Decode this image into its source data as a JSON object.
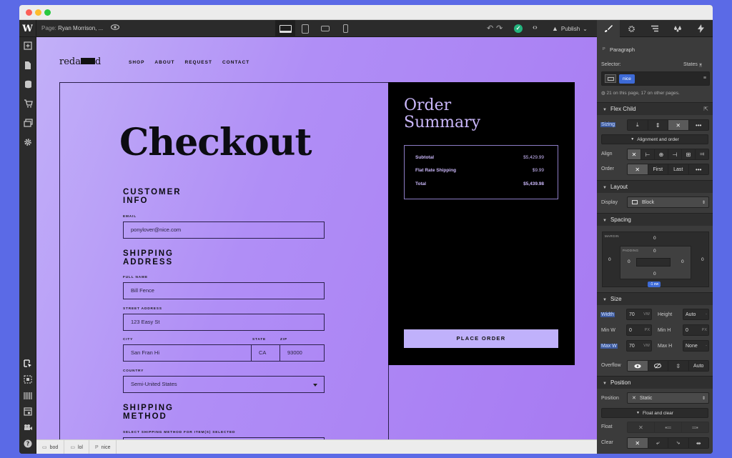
{
  "toolbar": {
    "logo": "W",
    "page_key": "Page:",
    "page_name": "Ryan Morrison, ...",
    "undo": "↶",
    "redo": "↷",
    "check": "✓",
    "code": "‹›",
    "publish_label": "Publish"
  },
  "site": {
    "logo_a": "reda",
    "logo_b": "d",
    "nav": [
      "SHOP",
      "ABOUT",
      "REQUEST",
      "CONTACT"
    ],
    "title": "Checkout",
    "customer_info_l1": "CUSTOMER",
    "customer_info_l2": "INFO",
    "email_label": "EMAIL",
    "email_value": "ponylover@nice.com",
    "shipping_address_l1": "SHIPPING",
    "shipping_address_l2": "ADDRESS",
    "full_name_label": "FULL NAME",
    "full_name_value": "Bill Fence",
    "street_label": "STREET ADDRESS",
    "street_value": "123 Easy St",
    "city_label": "CITY",
    "city_value": "San Fran Hi",
    "state_label": "STATE",
    "state_value": "CA",
    "zip_label": "ZIP",
    "zip_value": "93000",
    "country_label": "COUNTRY",
    "country_value": "Semi-United States",
    "shipping_method_l1": "SHIPPING",
    "shipping_method_l2": "METHOD",
    "shipping_method_hint": "SELECT SHIPPING METHOD FOR ITEM(S) SELECTED",
    "order_title_l1": "Order",
    "order_title_l2": "Summary",
    "subtotal_label": "Subtotal",
    "subtotal_value": "$5,429.99",
    "shipping_label": "Flat Rate Shipping",
    "shipping_value": "$9.99",
    "total_label": "Total",
    "total_value": "$5,439.98",
    "place_order": "PLACE ORDER"
  },
  "breadcrumbs": [
    {
      "icon": "▭",
      "label": "bod"
    },
    {
      "icon": "▭",
      "label": "lol"
    },
    {
      "icon": "P",
      "label": "nice"
    }
  ],
  "panel": {
    "element_icon": "P",
    "element_type": "Paragraph",
    "selector_label": "Selector:",
    "states_label": "States",
    "class_chip": "nice",
    "usage_text": "21 on this page, 17 on other pages.",
    "flex_child": "Flex Child",
    "sizing_label": "Sizing",
    "more": "•••",
    "alignment_order": "Alignment and order",
    "align_label": "Align",
    "order_label": "Order",
    "order_first": "First",
    "order_last": "Last",
    "layout": "Layout",
    "display_label": "Display",
    "display_value": "Block",
    "spacing": "Spacing",
    "margin_label": "MARGIN",
    "padding_label": "PADDING",
    "zero": "0",
    "auto_pill": "-1 ew",
    "size": "Size",
    "width_label": "Width",
    "width_value": "70",
    "width_unit": "VW",
    "height_label": "Height",
    "height_value": "Auto",
    "minw_label": "Min W",
    "minw_value": "0",
    "minh_label": "Min H",
    "minh_value": "0",
    "px": "PX",
    "maxw_label": "Max W",
    "maxw_value": "70",
    "maxh_label": "Max H",
    "maxh_value": "None",
    "overflow_label": "Overflow",
    "overflow_auto": "Auto",
    "position": "Position",
    "position_label": "Position",
    "position_value": "Static",
    "float_clear": "Float and clear",
    "float_label": "Float",
    "clear_label": "Clear"
  },
  "colors": {
    "canvas_gradient_start": "#c2b0f8",
    "canvas_gradient_end": "#a77af2",
    "order_panel": "#000000",
    "order_text": "#cbb8fb",
    "place_order_bg": "#c0b1fb",
    "publish_ok": "#24b47e",
    "selection_blue": "#3d6ad6"
  }
}
